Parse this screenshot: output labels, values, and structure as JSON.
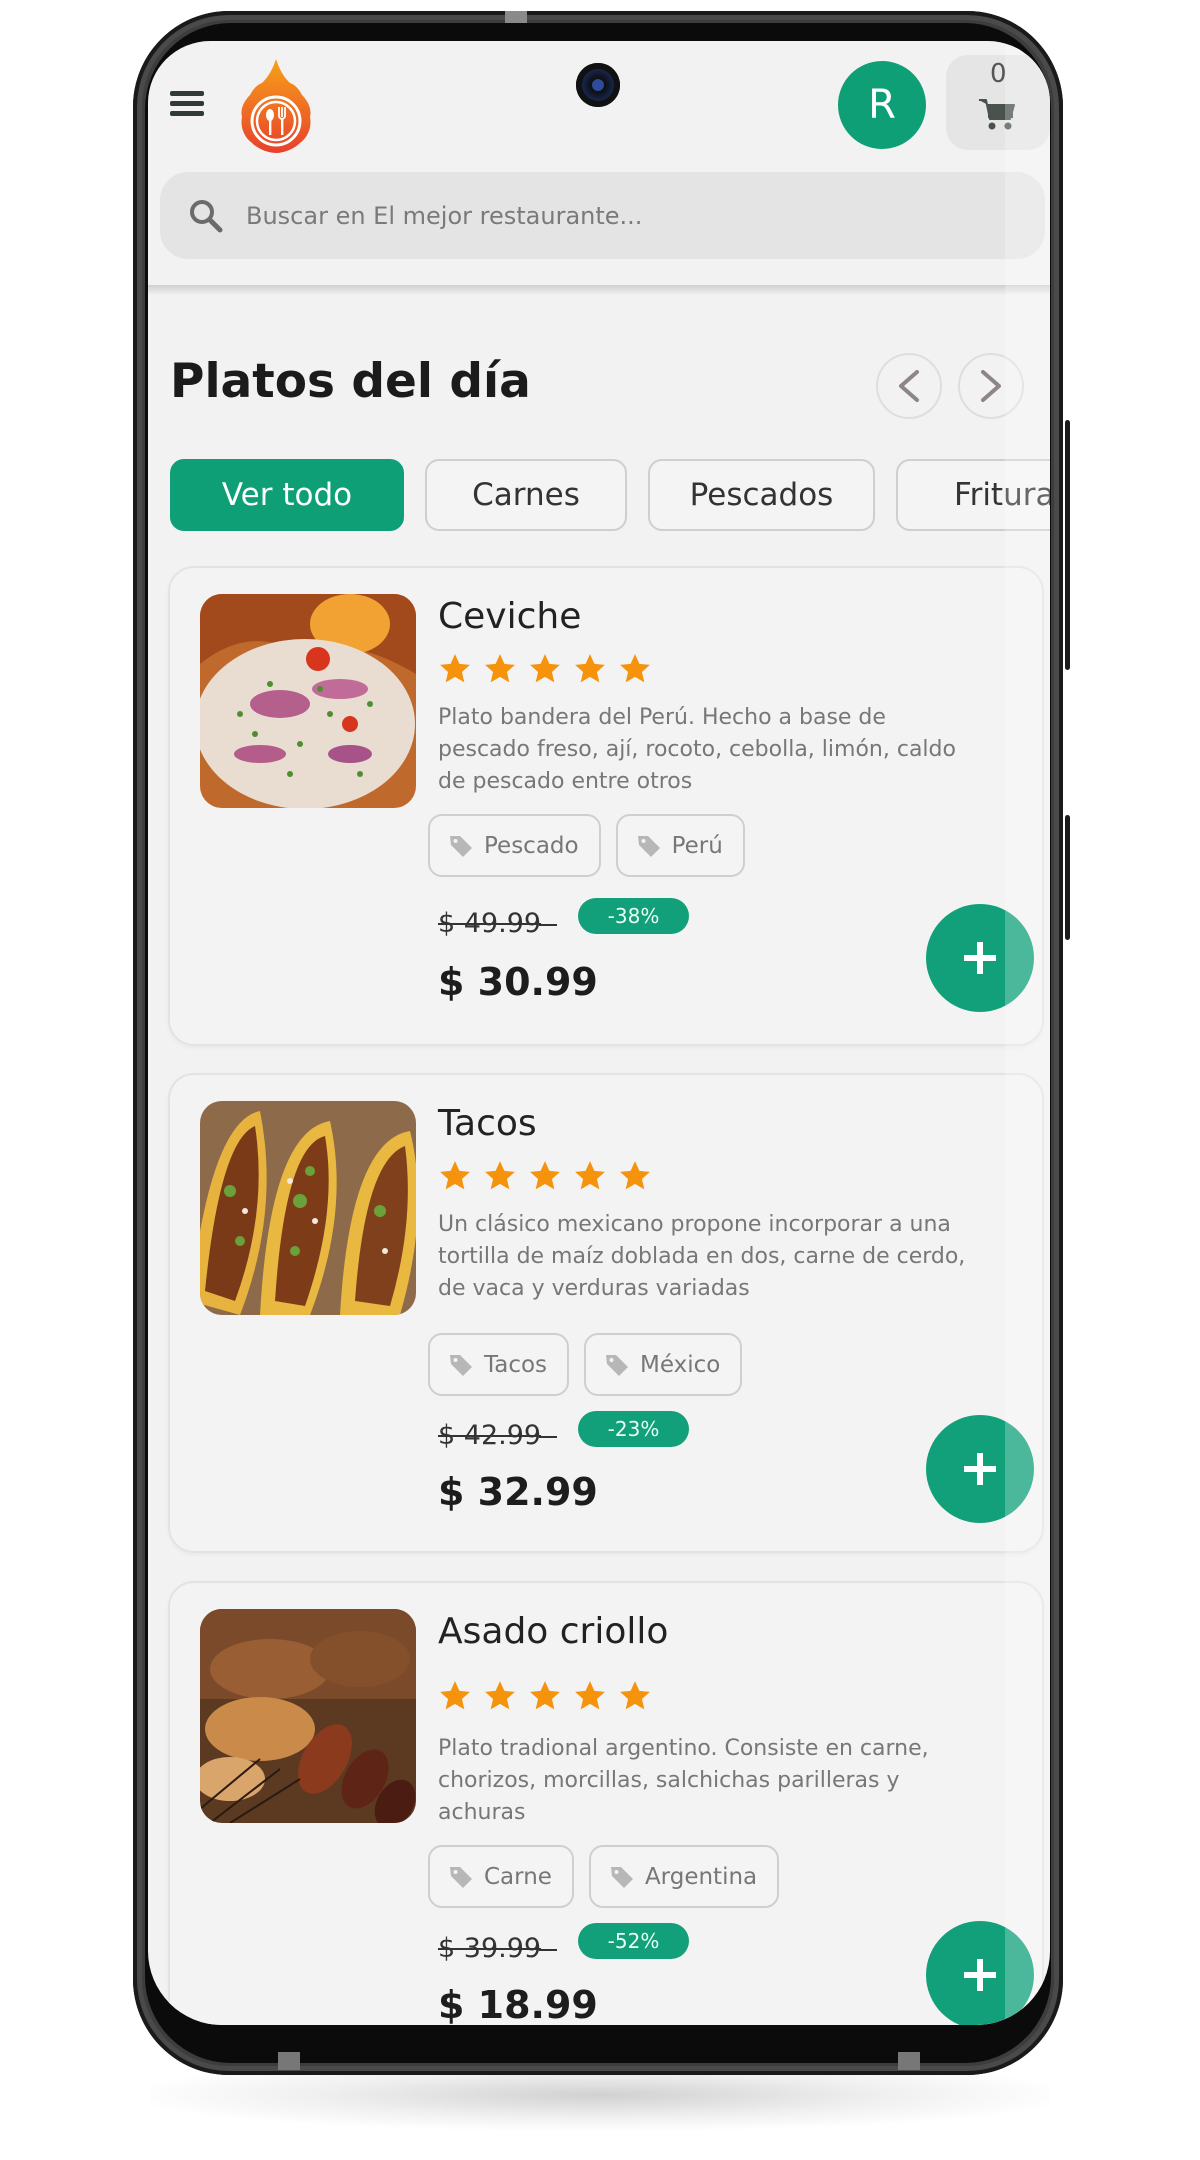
{
  "header": {
    "menu_icon": "hamburger-menu-icon",
    "logo": "restaurant-flame-logo",
    "avatar_initial": "R",
    "cart_count": "0",
    "cart_icon": "shopping-cart-icon"
  },
  "search": {
    "placeholder": "Buscar en El mejor restaurante...",
    "value": "",
    "icon": "search-icon"
  },
  "section": {
    "title": "Platos del día",
    "prev_icon": "chevron-left-icon",
    "next_icon": "chevron-right-icon"
  },
  "filters": [
    {
      "label": "Ver todo",
      "active": true
    },
    {
      "label": "Carnes",
      "active": false
    },
    {
      "label": "Pescados",
      "active": false
    },
    {
      "label": "Frituras",
      "active": false
    }
  ],
  "dishes": [
    {
      "name": "Ceviche",
      "rating": 5,
      "rating_max": 5,
      "description": "Plato bandera del Perú. Hecho a base de pescado freso, ají, rocoto, cebolla, limón, caldo de pescado entre otros",
      "tags": [
        "Pescado",
        "Perú"
      ],
      "old_price": "$ 49.99",
      "discount": "-38%",
      "price": "$ 30.99",
      "image": "ceviche-photo"
    },
    {
      "name": "Tacos",
      "rating": 5,
      "rating_max": 5,
      "description": "Un clásico mexicano propone incorporar a una tortilla de maíz doblada en dos, carne de cerdo, de vaca y verduras variadas",
      "tags": [
        "Tacos",
        "México"
      ],
      "old_price": "$ 42.99",
      "discount": "-23%",
      "price": "$ 32.99",
      "image": "tacos-photo"
    },
    {
      "name": "Asado criollo",
      "rating": 5,
      "rating_max": 5,
      "description": "Plato tradional argentino. Consiste en carne, chorizos, morcillas, salchichas parilleras y achuras",
      "tags": [
        "Carne",
        "Argentina"
      ],
      "old_price": "$ 39.99",
      "discount": "-52%",
      "price": "$ 18.99",
      "image": "asado-photo"
    }
  ],
  "colors": {
    "primary": "#0e9f77",
    "star": "#f5930c",
    "logo_top": "#f59a1b",
    "logo_bottom": "#e8472a",
    "background": "#f2f2f2"
  }
}
